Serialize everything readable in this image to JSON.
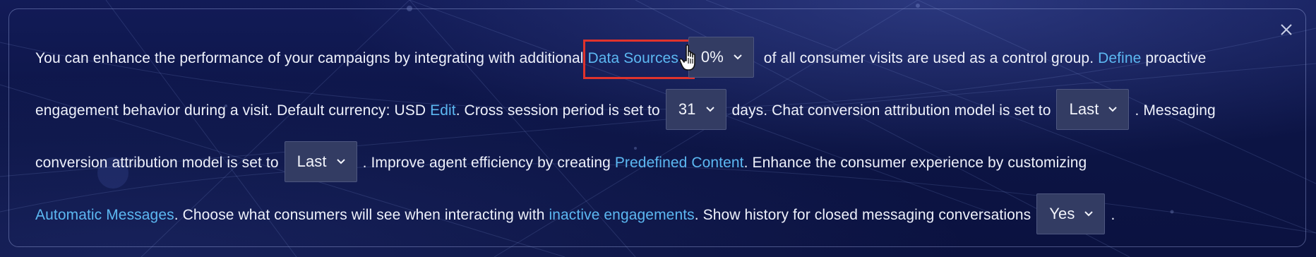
{
  "dialog": {
    "close_icon": "close-icon",
    "segments": {
      "s1": "You can enhance the performance of your campaigns by integrating with additional ",
      "link_data_sources": "Data Sources",
      "s2": ".",
      "dd_control_group": "0%",
      "s3": " of all consumer visits are used as a control group. ",
      "link_define": "Define",
      "s4": " proactive engagement behavior during a visit. Default currency: USD ",
      "link_edit": "Edit",
      "s5": ". Cross session period is set to",
      "dd_cross_session": "31",
      "s6": "days. Chat conversion attribution model is set to",
      "dd_chat_model": "Last",
      "s7": ". Messaging conversion attribution model is set to",
      "dd_messaging_model": "Last",
      "s8": ". Improve agent efficiency by creating ",
      "link_predefined_content": "Predefined Content",
      "s9": ". Enhance the consumer experience by customizing ",
      "link_automatic_messages": "Automatic Messages",
      "s10": ". Choose what consumers will see when interacting with ",
      "link_inactive_engagements": "inactive engagements",
      "s11": ". Show history for closed messaging conversations",
      "dd_show_history": "Yes",
      "s12": "."
    },
    "colors": {
      "link": "#5cb8f2",
      "text": "#eef1fb",
      "dropdown_bg": "#333c63",
      "highlight": "#e0332c"
    },
    "icons": {
      "chevron": "chevron-down-icon",
      "cursor": "hand-pointer-cursor-icon"
    }
  }
}
